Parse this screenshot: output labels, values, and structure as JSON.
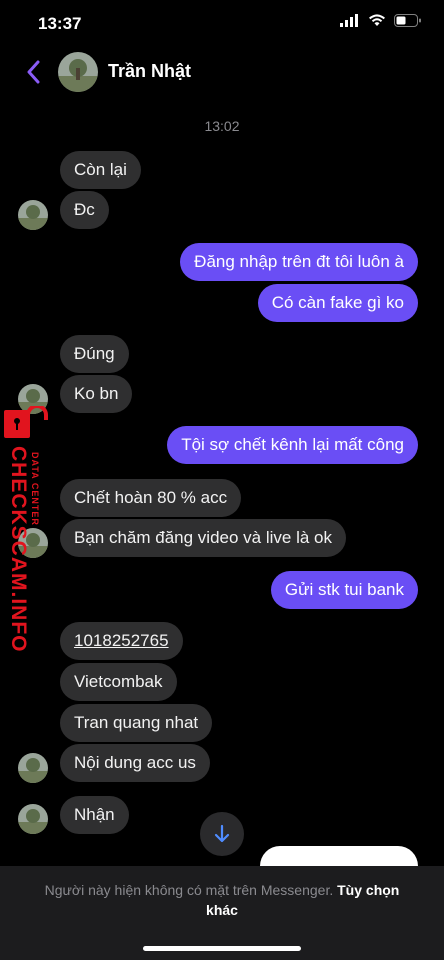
{
  "status": {
    "time": "13:37"
  },
  "header": {
    "contact_name": "Trần Nhật"
  },
  "chat": {
    "timestamp": "13:02",
    "messages": [
      {
        "side": "in",
        "text": "Còn lại"
      },
      {
        "side": "in",
        "text": "Đc"
      },
      {
        "side": "out",
        "text": "Đăng nhập trên đt tôi luôn à"
      },
      {
        "side": "out",
        "text": "Có càn fake gì ko"
      },
      {
        "side": "in",
        "text": "Đúng"
      },
      {
        "side": "in",
        "text": "Ko bn"
      },
      {
        "side": "out",
        "text": "Tội sợ chết kênh lại mất công"
      },
      {
        "side": "in",
        "text": "Chết hoàn 80 % acc"
      },
      {
        "side": "in",
        "text": "Bạn chăm đăng video và live là ok"
      },
      {
        "side": "out",
        "text": "Gửi stk tui bank"
      },
      {
        "side": "in",
        "text": "1018252765"
      },
      {
        "side": "in",
        "text": "Vietcombak"
      },
      {
        "side": "in",
        "text": "Tran quang nhat"
      },
      {
        "side": "in",
        "text": "Nội dung acc us"
      },
      {
        "side": "in",
        "text": "Nhận"
      }
    ]
  },
  "watermark": {
    "title": "CHECKSCAM.INFO",
    "subtitle": "DATA CENTER"
  },
  "footer": {
    "notice": "Người này hiện không có mặt trên Messenger.",
    "link": "Tùy chọn khác"
  },
  "colors": {
    "outgoing": "#6a4ef5",
    "incoming": "#2f2f30",
    "accent": "#8a5cf6",
    "watermark": "#e1141e"
  }
}
